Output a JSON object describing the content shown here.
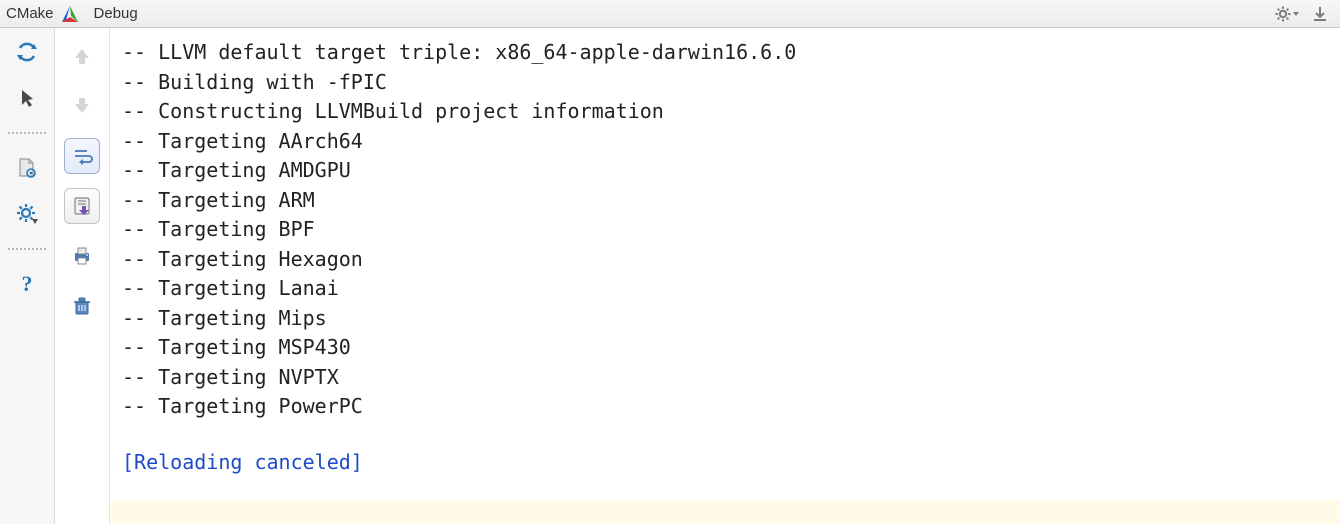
{
  "header": {
    "tool_name": "CMake",
    "config_name": "Debug"
  },
  "console": {
    "lines": [
      "-- LLVM default target triple: x86_64-apple-darwin16.6.0",
      "-- Building with -fPIC",
      "-- Constructing LLVMBuild project information",
      "-- Targeting AArch64",
      "-- Targeting AMDGPU",
      "-- Targeting ARM",
      "-- Targeting BPF",
      "-- Targeting Hexagon",
      "-- Targeting Lanai",
      "-- Targeting Mips",
      "-- Targeting MSP430",
      "-- Targeting NVPTX",
      "-- Targeting PowerPC"
    ],
    "status": "[Reloading canceled]"
  }
}
